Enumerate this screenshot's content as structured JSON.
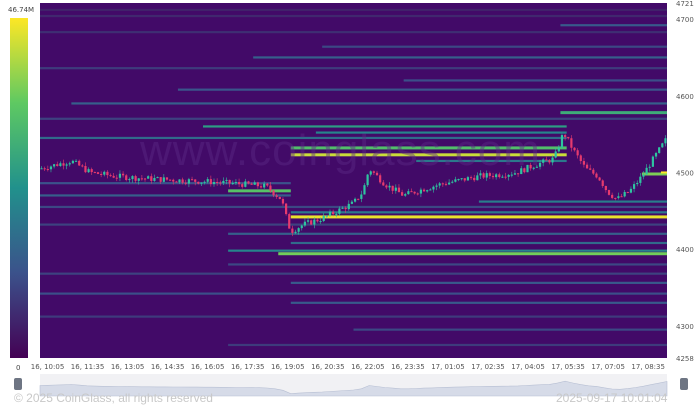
{
  "chart_data": {
    "type": "heatmap",
    "description_overlay": "price candlesticks over liquidation levels",
    "colorbar": {
      "max_label": "46.74M",
      "min_label": "0"
    },
    "y_axis": {
      "min": 4258,
      "max": 4721,
      "ticks": [
        "4721",
        "4700",
        "4600",
        "4500",
        "4400",
        "4300",
        "4258"
      ]
    },
    "x_axis": {
      "ticks": [
        "16, 10:05",
        "16, 11:35",
        "16, 13:05",
        "16, 14:35",
        "16, 16:05",
        "16, 17:35",
        "16, 19:05",
        "16, 20:35",
        "16, 22:05",
        "16, 23:35",
        "17, 01:05",
        "17, 02:35",
        "17, 04:05",
        "17, 05:35",
        "17, 07:05",
        "17, 08:35"
      ]
    },
    "current_price": 4500,
    "price_path": [
      [
        0,
        4505
      ],
      [
        0.05,
        4515
      ],
      [
        0.08,
        4500
      ],
      [
        0.12,
        4495
      ],
      [
        0.17,
        4492
      ],
      [
        0.22,
        4490
      ],
      [
        0.27,
        4488
      ],
      [
        0.32,
        4485
      ],
      [
        0.36,
        4482
      ],
      [
        0.385,
        4465
      ],
      [
        0.395,
        4435
      ],
      [
        0.4,
        4423
      ],
      [
        0.42,
        4432
      ],
      [
        0.45,
        4440
      ],
      [
        0.48,
        4452
      ],
      [
        0.5,
        4460
      ],
      [
        0.515,
        4475
      ],
      [
        0.525,
        4505
      ],
      [
        0.55,
        4485
      ],
      [
        0.58,
        4470
      ],
      [
        0.61,
        4478
      ],
      [
        0.64,
        4485
      ],
      [
        0.67,
        4490
      ],
      [
        0.7,
        4495
      ],
      [
        0.73,
        4497
      ],
      [
        0.76,
        4500
      ],
      [
        0.79,
        4510
      ],
      [
        0.82,
        4518
      ],
      [
        0.835,
        4552
      ],
      [
        0.85,
        4530
      ],
      [
        0.87,
        4505
      ],
      [
        0.89,
        4495
      ],
      [
        0.905,
        4475
      ],
      [
        0.92,
        4465
      ],
      [
        0.94,
        4475
      ],
      [
        0.96,
        4495
      ],
      [
        0.98,
        4520
      ],
      [
        1.0,
        4545
      ]
    ],
    "liquidation_levels": [
      {
        "price": 4712,
        "x0": 0.0,
        "x1": 1.0,
        "intensity": 0.1
      },
      {
        "price": 4704,
        "x0": 0.0,
        "x1": 1.0,
        "intensity": 0.12
      },
      {
        "price": 4692,
        "x0": 0.83,
        "x1": 1.0,
        "intensity": 0.28
      },
      {
        "price": 4683,
        "x0": 0.0,
        "x1": 1.0,
        "intensity": 0.14
      },
      {
        "price": 4664,
        "x0": 0.45,
        "x1": 1.0,
        "intensity": 0.22
      },
      {
        "price": 4650,
        "x0": 0.34,
        "x1": 1.0,
        "intensity": 0.3
      },
      {
        "price": 4636,
        "x0": 0.0,
        "x1": 1.0,
        "intensity": 0.18
      },
      {
        "price": 4620,
        "x0": 0.58,
        "x1": 1.0,
        "intensity": 0.24
      },
      {
        "price": 4608,
        "x0": 0.22,
        "x1": 1.0,
        "intensity": 0.26
      },
      {
        "price": 4590,
        "x0": 0.05,
        "x1": 1.0,
        "intensity": 0.3
      },
      {
        "price": 4578,
        "x0": 0.83,
        "x1": 1.0,
        "intensity": 0.62
      },
      {
        "price": 4570,
        "x0": 0.0,
        "x1": 1.0,
        "intensity": 0.2
      },
      {
        "price": 4560,
        "x0": 0.26,
        "x1": 0.84,
        "intensity": 0.55
      },
      {
        "price": 4552,
        "x0": 0.44,
        "x1": 0.84,
        "intensity": 0.45
      },
      {
        "price": 4545,
        "x0": 0.0,
        "x1": 0.84,
        "intensity": 0.35
      },
      {
        "price": 4532,
        "x0": 0.4,
        "x1": 0.84,
        "intensity": 0.7
      },
      {
        "price": 4523,
        "x0": 0.4,
        "x1": 0.84,
        "intensity": 0.92
      },
      {
        "price": 4515,
        "x0": 0.6,
        "x1": 0.84,
        "intensity": 0.4
      },
      {
        "price": 4498,
        "x0": 0.96,
        "x1": 1.0,
        "intensity": 0.8
      },
      {
        "price": 4486,
        "x0": 0.0,
        "x1": 0.4,
        "intensity": 0.25
      },
      {
        "price": 4476,
        "x0": 0.3,
        "x1": 0.4,
        "intensity": 0.72
      },
      {
        "price": 4470,
        "x0": 0.0,
        "x1": 0.4,
        "intensity": 0.3
      },
      {
        "price": 4462,
        "x0": 0.7,
        "x1": 1.0,
        "intensity": 0.42
      },
      {
        "price": 4455,
        "x0": 0.0,
        "x1": 1.0,
        "intensity": 0.22
      },
      {
        "price": 4448,
        "x0": 0.4,
        "x1": 1.0,
        "intensity": 0.4
      },
      {
        "price": 4442,
        "x0": 0.4,
        "x1": 1.0,
        "intensity": 0.97
      },
      {
        "price": 4432,
        "x0": 0.0,
        "x1": 1.0,
        "intensity": 0.2
      },
      {
        "price": 4420,
        "x0": 0.3,
        "x1": 1.0,
        "intensity": 0.3
      },
      {
        "price": 4408,
        "x0": 0.4,
        "x1": 1.0,
        "intensity": 0.35
      },
      {
        "price": 4398,
        "x0": 0.3,
        "x1": 1.0,
        "intensity": 0.45
      },
      {
        "price": 4394,
        "x0": 0.38,
        "x1": 1.0,
        "intensity": 0.78
      },
      {
        "price": 4380,
        "x0": 0.3,
        "x1": 1.0,
        "intensity": 0.22
      },
      {
        "price": 4368,
        "x0": 0.0,
        "x1": 1.0,
        "intensity": 0.2
      },
      {
        "price": 4356,
        "x0": 0.4,
        "x1": 1.0,
        "intensity": 0.28
      },
      {
        "price": 4342,
        "x0": 0.0,
        "x1": 1.0,
        "intensity": 0.24
      },
      {
        "price": 4330,
        "x0": 0.4,
        "x1": 1.0,
        "intensity": 0.28
      },
      {
        "price": 4312,
        "x0": 0.0,
        "x1": 1.0,
        "intensity": 0.18
      },
      {
        "price": 4295,
        "x0": 0.5,
        "x1": 1.0,
        "intensity": 0.22
      },
      {
        "price": 4275,
        "x0": 0.3,
        "x1": 1.0,
        "intensity": 0.18
      }
    ],
    "grid": false,
    "legend": "colorbar-left"
  },
  "watermark": "www.coinglass.com",
  "footer": {
    "copyright": "© 2025 CoinGlass, all rights reserved",
    "timestamp": "2025-09-17 10:01:04"
  },
  "colors": {
    "background": "#420a68",
    "low": "#3b0f70",
    "mid": "#2a9d8f",
    "high": "#f2f21a",
    "candle_up": "#2ec4a0",
    "candle_down": "#e63a6e"
  }
}
